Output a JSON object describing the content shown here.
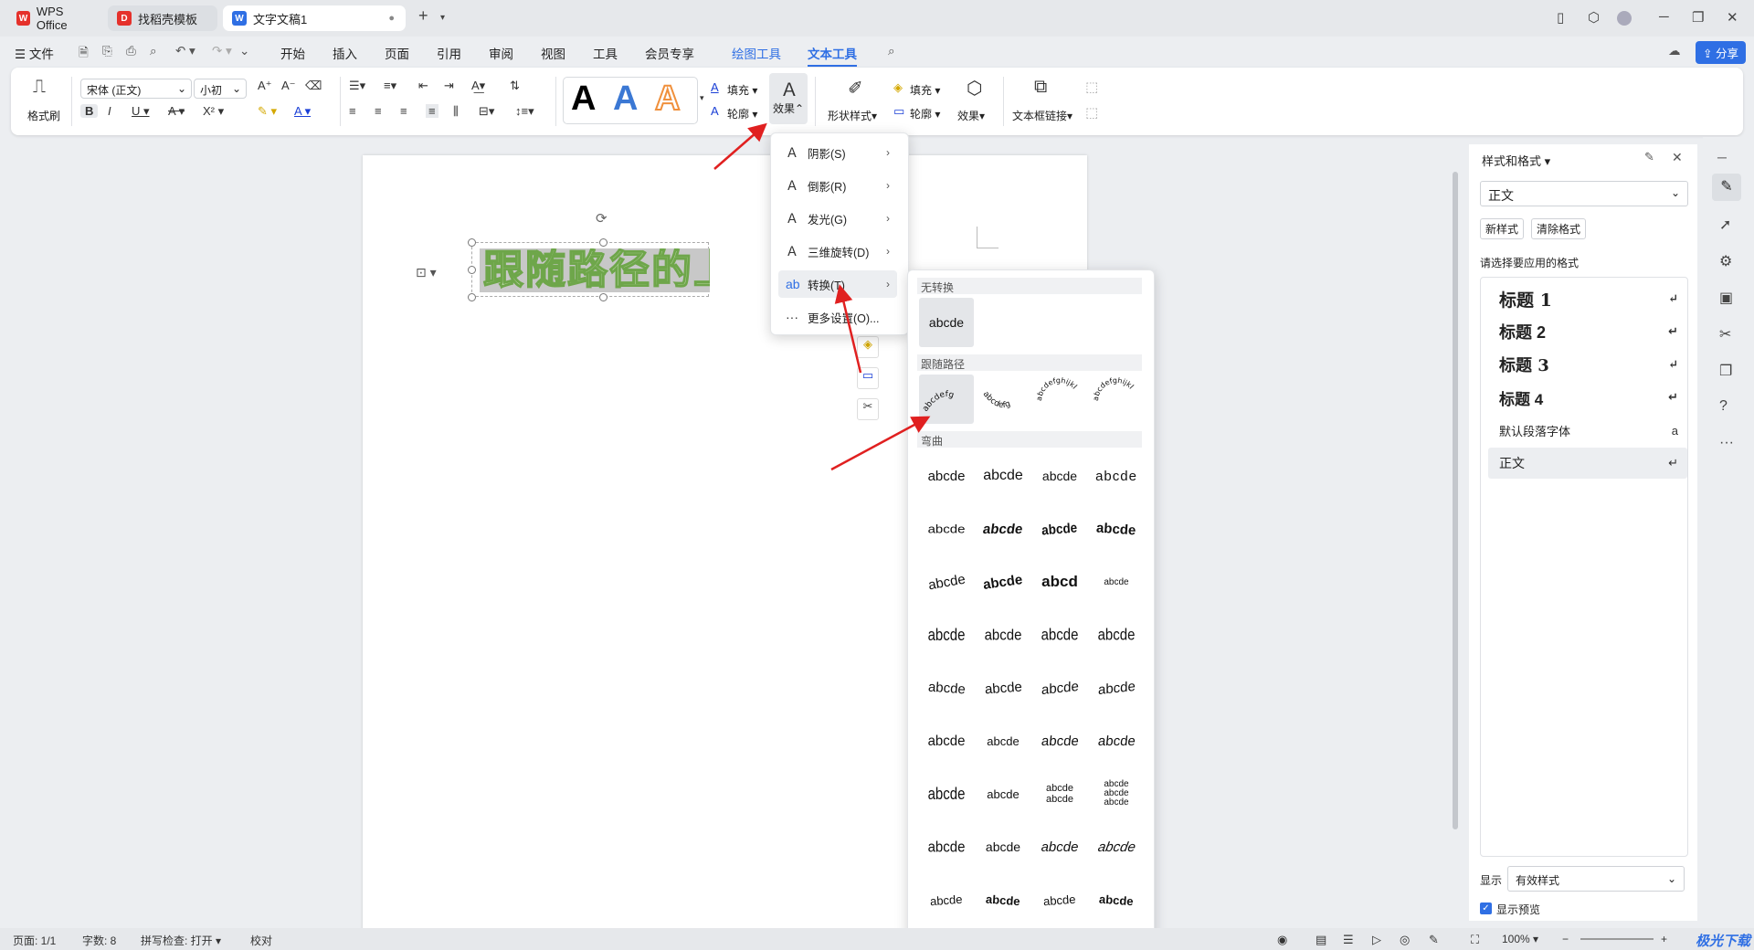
{
  "tabs": [
    {
      "label": "WPS Office",
      "icon": "wps-logo-icon"
    },
    {
      "label": "找稻壳模板",
      "icon": "docer-icon"
    },
    {
      "label": "文字文稿1",
      "icon": "writer-doc-icon"
    }
  ],
  "menubar": {
    "file_label": "文件",
    "items": [
      "开始",
      "插入",
      "页面",
      "引用",
      "审阅",
      "视图",
      "工具",
      "会员专享",
      "绘图工具",
      "文本工具"
    ],
    "active": "文本工具",
    "share_label": "分享"
  },
  "ribbon": {
    "format_painter": "格式刷",
    "font_name": "宋体 (正文)",
    "font_size": "小初",
    "style_letters": [
      "A",
      "A",
      "A"
    ],
    "fill_label": "填充",
    "outline_label": "轮廓",
    "effect_label": "效果",
    "shape_style_label": "形状样式",
    "shape_fill_label": "填充",
    "shape_outline_label": "轮廓",
    "shape_effect_label": "效果",
    "textbox_link_label": "文本框链接"
  },
  "document": {
    "text": "跟随路径的上弯"
  },
  "effect_menu": {
    "items": [
      {
        "label": "阴影(S)",
        "has_submenu": true
      },
      {
        "label": "倒影(R)",
        "has_submenu": true
      },
      {
        "label": "发光(G)",
        "has_submenu": true
      },
      {
        "label": "三维旋转(D)",
        "has_submenu": true
      },
      {
        "label": "转换(T)",
        "has_submenu": true
      },
      {
        "label": "更多设置(O)...",
        "has_submenu": false
      }
    ]
  },
  "transform_submenu": {
    "no_transform_title": "无转换",
    "no_transform_sample": "abcde",
    "follow_path_title": "跟随路径",
    "follow_path_samples": [
      "abcdefg",
      "abcdefg",
      "abcdefghijkl",
      "abcdefghijkl"
    ],
    "warp_title": "弯曲",
    "warp_samples": [
      "abcde",
      "abcde",
      "abcde",
      "abcde",
      "abcde",
      "abcde",
      "abcde",
      "abcde",
      "abcde",
      "abcde",
      "abcd",
      "abcde",
      "abcde",
      "abcde",
      "abcde",
      "abcde",
      "abcde",
      "abcde",
      "abcde",
      "abcde",
      "abcde",
      "abcde",
      "abcde",
      "abcde",
      "abcde",
      "abcde",
      "abcde abcde",
      "abcde abcde abcde",
      "abcde",
      "abcde",
      "abcde",
      "abcde",
      "abcde",
      "abcde",
      "abcde",
      "abcde"
    ]
  },
  "style_panel": {
    "title": "样式和格式",
    "current_style": "正文",
    "new_style_btn": "新样式",
    "clear_format_btn": "清除格式",
    "prompt": "请选择要应用的格式",
    "styles": [
      "标题  1",
      "标题  2",
      "标题  3",
      "标题  4",
      "默认段落字体",
      "正文"
    ],
    "show_label": "显示",
    "show_value": "有效样式",
    "preview_label": "显示预览"
  },
  "statusbar": {
    "page": "页面: 1/1",
    "words": "字数: 8",
    "spell": "拼写检查: 打开",
    "proof": "校对",
    "zoom": "100%"
  },
  "watermark": "极光下载站",
  "colors": {
    "accent": "#2f6fe4",
    "text_green": "#6ea64a",
    "annotation_red": "#e02020"
  }
}
